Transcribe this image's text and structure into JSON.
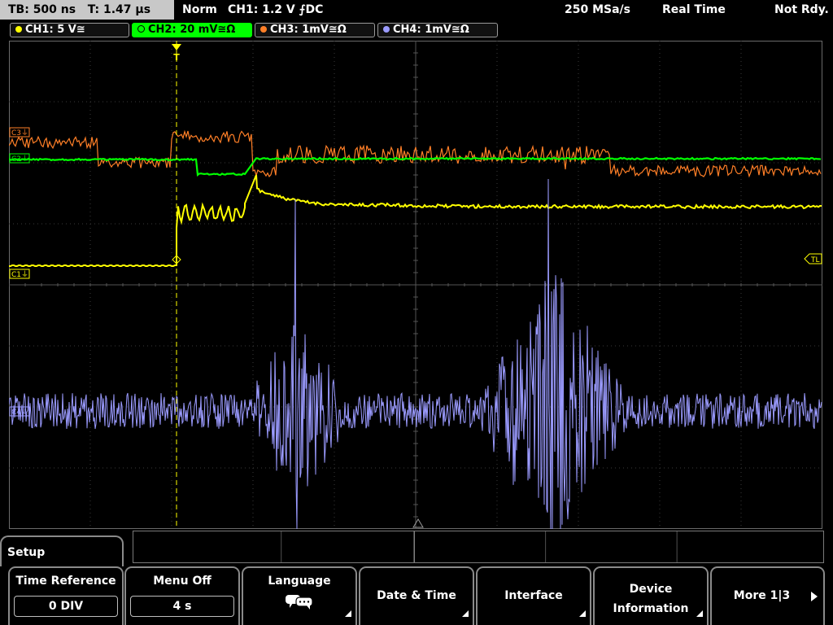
{
  "status": {
    "timebase": "TB: 500 ns",
    "trigger_time": "T: 1.47 µs",
    "mode": "Norm",
    "trigger": "CH1: 1.2 V ⨍DC",
    "sample_rate": "250 MSa/s",
    "acq_mode": "Real Time",
    "state": "Not Rdy."
  },
  "channels": [
    {
      "label": "CH1: 5 V≅",
      "color": "#ffff00",
      "active": false
    },
    {
      "label": "CH2: 20 mV≅Ω",
      "color": "#00ff00",
      "active": true
    },
    {
      "label": "CH3: 1mV≅Ω",
      "color": "#ff7f27",
      "active": false
    },
    {
      "label": "CH4: 1mV≅Ω",
      "color": "#9b9bff",
      "active": false
    }
  ],
  "markers": {
    "ch3": "C3⏚",
    "ch2": "C2⏚",
    "ch1": "C1⏚",
    "ch4": "C4⏚",
    "trigger_level": "TL",
    "trigger_pos": "T"
  },
  "menu": {
    "title": "Setup",
    "time_reference": {
      "label": "Time Reference",
      "value": "0 DIV"
    },
    "menu_off": {
      "label": "Menu Off",
      "value": "4 s"
    },
    "language": {
      "label": "Language",
      "icon": "speech-bubbles-icon"
    },
    "date_time": {
      "label": "Date & Time"
    },
    "interface": {
      "label": "Interface"
    },
    "device_info": {
      "line1": "Device",
      "line2": "Information"
    },
    "more": {
      "label": "More 1|3"
    }
  },
  "colors": {
    "ch1": "#ffff00",
    "ch2": "#00ff00",
    "ch3": "#ff7f27",
    "ch4": "#9b9bff",
    "grid": "#3a3a3a",
    "tab_active": "#00ff00"
  }
}
